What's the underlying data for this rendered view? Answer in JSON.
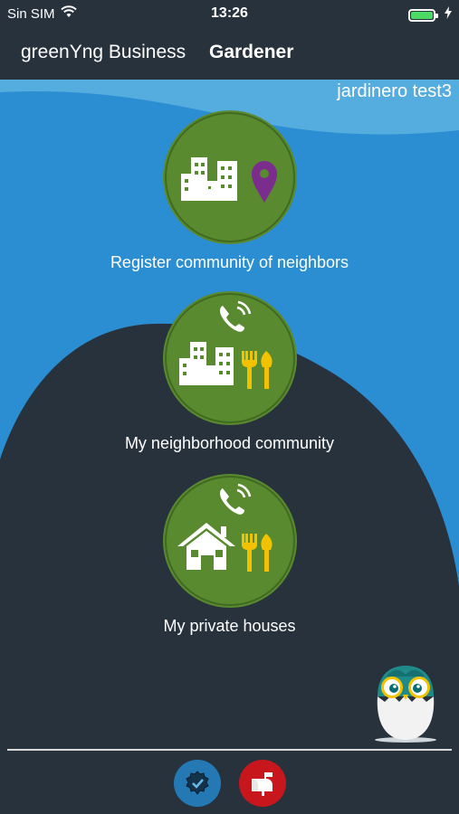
{
  "status": {
    "carrier": "Sin SIM",
    "time": "13:26"
  },
  "nav": {
    "app_title": "greenYng Business",
    "role": "Gardener"
  },
  "user": {
    "name": "jardinero test3"
  },
  "menu": [
    {
      "label": "Register community of neighbors"
    },
    {
      "label": "My neighborhood community"
    },
    {
      "label": "My private houses"
    }
  ],
  "colors": {
    "sky_blue": "#2b8ed2",
    "dark_bg": "#27323d",
    "circle_green": "#5a8a30",
    "tool_yellow": "#f2c200",
    "pin_purple": "#7b2d8e"
  },
  "tabs": [
    {
      "icon": "badge-check-icon"
    },
    {
      "icon": "mailbox-icon"
    }
  ]
}
